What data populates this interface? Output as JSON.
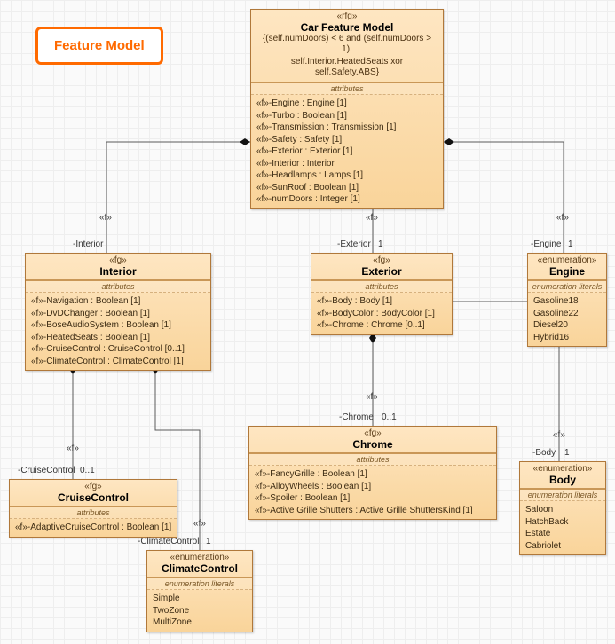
{
  "badge": {
    "label": "Feature Model"
  },
  "root": {
    "stereo": "«rfg»",
    "title": "Car Feature Model",
    "constraint_line1": "{(self.numDoors) < 6 and (self.numDoors  > 1).",
    "constraint_line2": "self.Interior.HeatedSeats xor self.Safety.ABS}",
    "section": "attributes",
    "attrs": [
      "«f»-Engine : Engine [1]",
      "«f»-Turbo : Boolean [1]",
      "«f»-Transmission : Transmission [1]",
      "«f»-Safety : Safety [1]",
      "«f»-Exterior : Exterior [1]",
      "«f»-Interior : Interior",
      "«f»-Headlamps : Lamps [1]",
      "«f»-SunRoof : Boolean [1]",
      "«f»-numDoors : Integer [1]"
    ]
  },
  "interior": {
    "stereo": "«fg»",
    "title": "Interior",
    "section": "attributes",
    "attrs": [
      "«f»-Navigation : Boolean [1]",
      "«f»-DvDChanger : Boolean [1]",
      "«f»-BoseAudioSystem : Boolean [1]",
      "«f»-HeatedSeats : Boolean [1]",
      "«f»-CruiseControl : CruiseControl [0..1]",
      "«f»-ClimateControl : ClimateControl [1]"
    ]
  },
  "exterior": {
    "stereo": "«fg»",
    "title": "Exterior",
    "section": "attributes",
    "attrs": [
      "«f»-Body : Body [1]",
      "«f»-BodyColor : BodyColor [1]",
      "«f»-Chrome : Chrome [0..1]"
    ]
  },
  "engine": {
    "stereo": "«enumeration»",
    "title": "Engine",
    "section": "enumeration literals",
    "literals": [
      "Gasoline18",
      "Gasoline22",
      "Diesel20",
      "Hybrid16"
    ]
  },
  "chrome": {
    "stereo": "«fg»",
    "title": "Chrome",
    "section": "attributes",
    "attrs": [
      "«f»-FancyGrille : Boolean [1]",
      "«f»-AlloyWheels : Boolean [1]",
      "«f»-Spoiler : Boolean [1]",
      "«f»-Active Grille Shutters : Active Grille ShuttersKind [1]"
    ]
  },
  "body": {
    "stereo": "«enumeration»",
    "title": "Body",
    "section": "enumeration literals",
    "literals": [
      "Saloon",
      "HatchBack",
      "Estate",
      "Cabriolet"
    ]
  },
  "cruise": {
    "stereo": "«fg»",
    "title": "CruiseControl",
    "section": "attributes",
    "attrs": [
      "«f»-AdaptiveCruiseControl : Boolean [1]"
    ]
  },
  "climate": {
    "stereo": "«enumeration»",
    "title": "ClimateControl",
    "section": "enumeration literals",
    "literals": [
      "Simple",
      "TwoZone",
      "MultiZone"
    ]
  },
  "edges": {
    "interior_f": "«f»",
    "interior_role": "-Interior",
    "exterior_f": "«f»",
    "exterior_role": "-Exterior",
    "exterior_mult": "1",
    "engine_f": "«f»",
    "engine_role": "-Engine",
    "engine_mult": "1",
    "chrome_f": "«f»",
    "chrome_role": "-Chrome",
    "chrome_mult": "0..1",
    "body_f": "«f»",
    "body_role": "-Body",
    "body_mult": "1",
    "cruise_f": "«f»",
    "cruise_role": "-CruiseControl",
    "cruise_mult": "0..1",
    "climate_f": "«f»",
    "climate_role": "-ClimateControl",
    "climate_mult": "1"
  }
}
